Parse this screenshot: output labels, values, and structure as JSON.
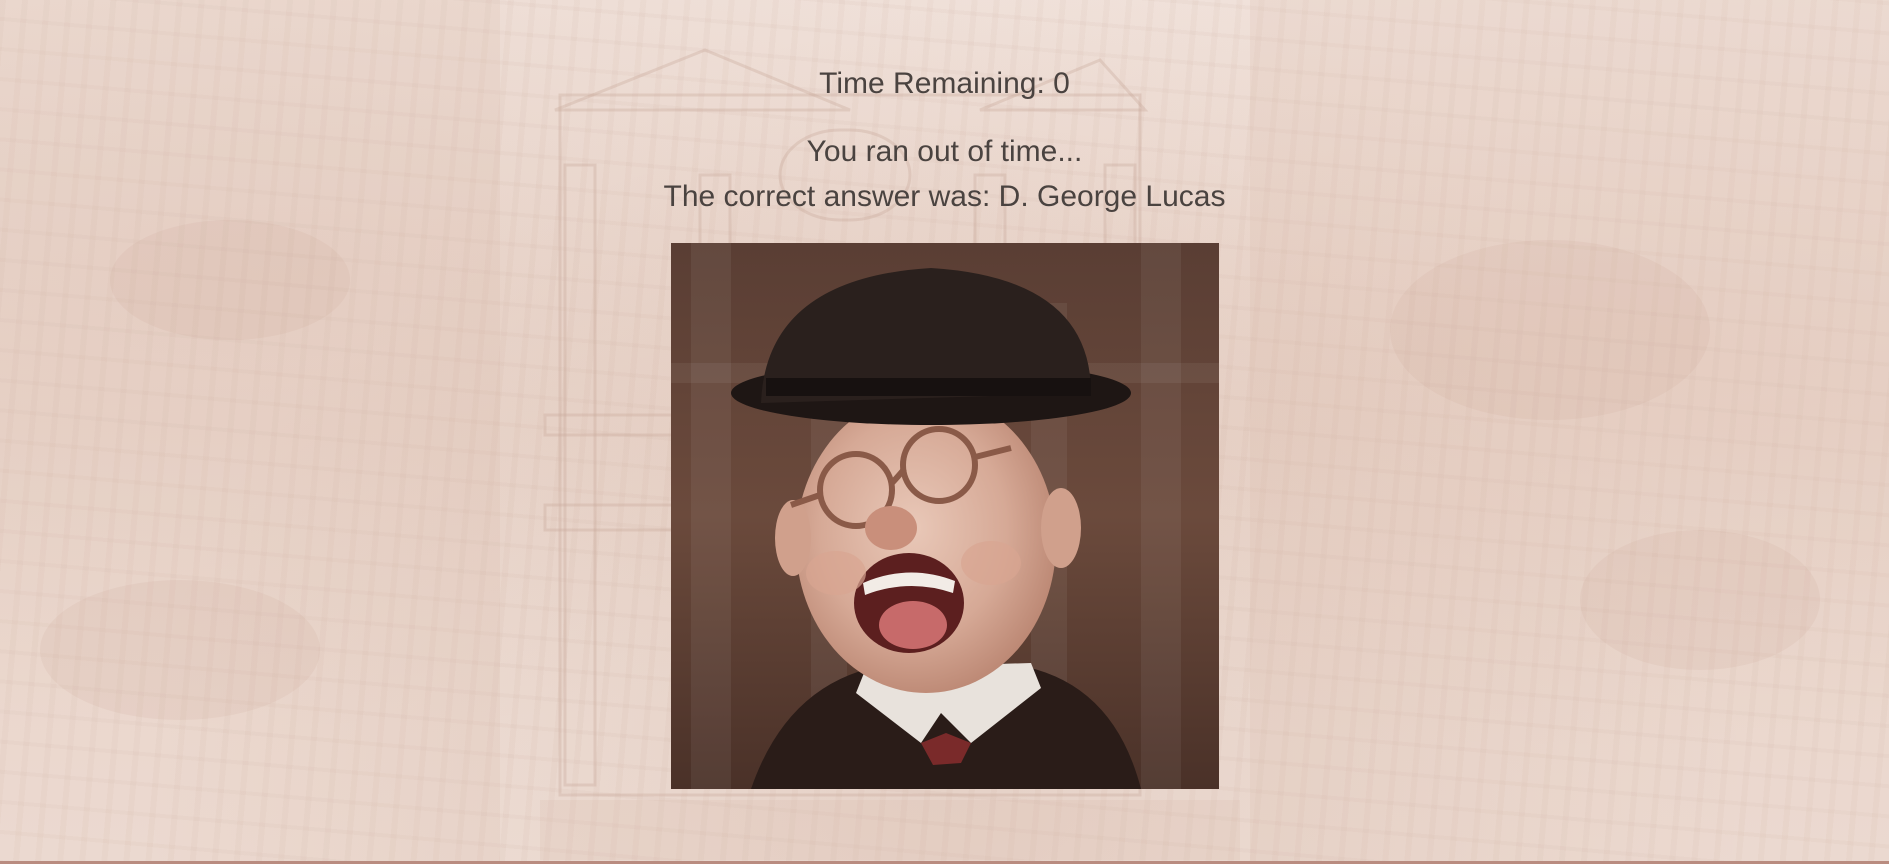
{
  "game": {
    "time_label": "Time Remaining:",
    "time_value": "0",
    "timeout_message": "You ran out of time...",
    "answer_prefix": "The correct answer was:",
    "correct_answer": "D. George Lucas"
  },
  "result_image": {
    "subject": "laughing-man-in-bowler-hat-and-round-glasses"
  },
  "colors": {
    "text": "#4a4340",
    "background": "#efe0d8",
    "bottom_bar": "#b98c80"
  }
}
